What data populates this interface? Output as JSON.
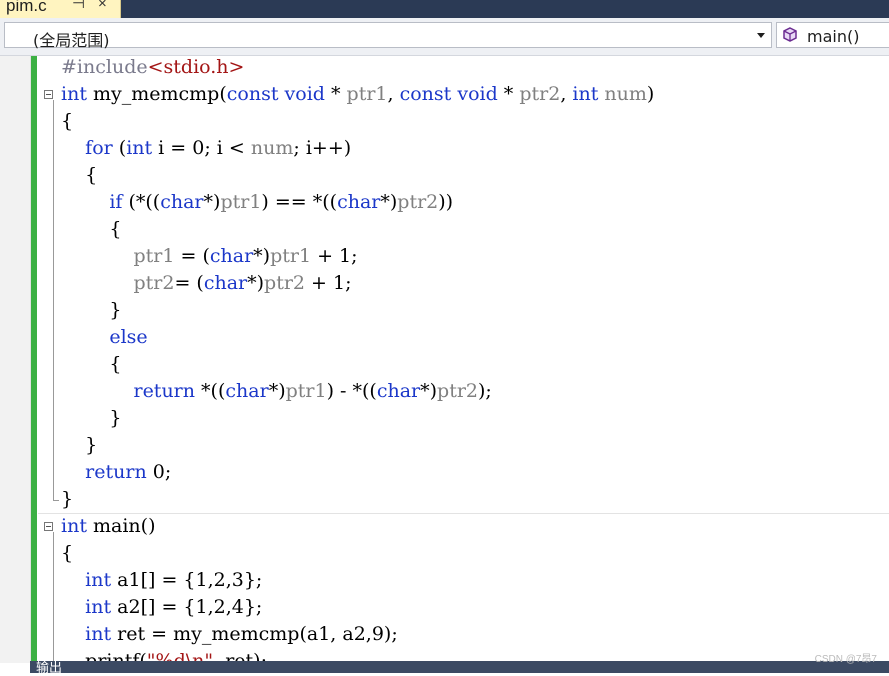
{
  "tab": {
    "filename": "pim.c",
    "pin_glyph": "⊣",
    "close_glyph": "×"
  },
  "navbar": {
    "scope": "(全局范围)",
    "member": "main()"
  },
  "code": [
    [
      {
        "t": "#include",
        "c": "pp"
      },
      {
        "t": "<stdio.h>",
        "c": "str"
      }
    ],
    [
      {
        "t": "int",
        "c": "kw"
      },
      {
        "t": " my_memcmp(",
        "c": ""
      },
      {
        "t": "const",
        "c": "kw"
      },
      {
        "t": " ",
        "c": ""
      },
      {
        "t": "void",
        "c": "kw"
      },
      {
        "t": " * ",
        "c": ""
      },
      {
        "t": "ptr1",
        "c": "param"
      },
      {
        "t": ", ",
        "c": ""
      },
      {
        "t": "const",
        "c": "kw"
      },
      {
        "t": " ",
        "c": ""
      },
      {
        "t": "void",
        "c": "kw"
      },
      {
        "t": " * ",
        "c": ""
      },
      {
        "t": "ptr2",
        "c": "param"
      },
      {
        "t": ", ",
        "c": ""
      },
      {
        "t": "int",
        "c": "kw"
      },
      {
        "t": " ",
        "c": ""
      },
      {
        "t": "num",
        "c": "param"
      },
      {
        "t": ")",
        "c": ""
      }
    ],
    [
      {
        "t": "{",
        "c": ""
      }
    ],
    [
      {
        "t": "    ",
        "c": ""
      },
      {
        "t": "for",
        "c": "kw"
      },
      {
        "t": " (",
        "c": ""
      },
      {
        "t": "int",
        "c": "kw"
      },
      {
        "t": " i = 0; i < ",
        "c": ""
      },
      {
        "t": "num",
        "c": "param"
      },
      {
        "t": "; i++)",
        "c": ""
      }
    ],
    [
      {
        "t": "    {",
        "c": ""
      }
    ],
    [
      {
        "t": "        ",
        "c": ""
      },
      {
        "t": "if",
        "c": "kw"
      },
      {
        "t": " (*((",
        "c": ""
      },
      {
        "t": "char",
        "c": "kw"
      },
      {
        "t": "*)",
        "c": ""
      },
      {
        "t": "ptr1",
        "c": "param"
      },
      {
        "t": ") == *((",
        "c": ""
      },
      {
        "t": "char",
        "c": "kw"
      },
      {
        "t": "*)",
        "c": ""
      },
      {
        "t": "ptr2",
        "c": "param"
      },
      {
        "t": "))",
        "c": ""
      }
    ],
    [
      {
        "t": "        {",
        "c": ""
      }
    ],
    [
      {
        "t": "            ",
        "c": ""
      },
      {
        "t": "ptr1",
        "c": "param"
      },
      {
        "t": " = (",
        "c": ""
      },
      {
        "t": "char",
        "c": "kw"
      },
      {
        "t": "*)",
        "c": ""
      },
      {
        "t": "ptr1",
        "c": "param"
      },
      {
        "t": " + 1;",
        "c": ""
      }
    ],
    [
      {
        "t": "            ",
        "c": ""
      },
      {
        "t": "ptr2",
        "c": "param"
      },
      {
        "t": "= (",
        "c": ""
      },
      {
        "t": "char",
        "c": "kw"
      },
      {
        "t": "*)",
        "c": ""
      },
      {
        "t": "ptr2",
        "c": "param"
      },
      {
        "t": " + 1;",
        "c": ""
      }
    ],
    [
      {
        "t": "        }",
        "c": ""
      }
    ],
    [
      {
        "t": "        ",
        "c": ""
      },
      {
        "t": "else",
        "c": "kw"
      }
    ],
    [
      {
        "t": "        {",
        "c": ""
      }
    ],
    [
      {
        "t": "            ",
        "c": ""
      },
      {
        "t": "return",
        "c": "kw"
      },
      {
        "t": " *((",
        "c": ""
      },
      {
        "t": "char",
        "c": "kw"
      },
      {
        "t": "*)",
        "c": ""
      },
      {
        "t": "ptr1",
        "c": "param"
      },
      {
        "t": ") - *((",
        "c": ""
      },
      {
        "t": "char",
        "c": "kw"
      },
      {
        "t": "*)",
        "c": ""
      },
      {
        "t": "ptr2",
        "c": "param"
      },
      {
        "t": ");",
        "c": ""
      }
    ],
    [
      {
        "t": "        }",
        "c": ""
      }
    ],
    [
      {
        "t": "    }",
        "c": ""
      }
    ],
    [
      {
        "t": "    ",
        "c": ""
      },
      {
        "t": "return",
        "c": "kw"
      },
      {
        "t": " 0;",
        "c": ""
      }
    ],
    [
      {
        "t": "}",
        "c": ""
      }
    ],
    [
      {
        "t": "int",
        "c": "kw"
      },
      {
        "t": " main()",
        "c": ""
      }
    ],
    [
      {
        "t": "{",
        "c": ""
      }
    ],
    [
      {
        "t": "    ",
        "c": ""
      },
      {
        "t": "int",
        "c": "kw"
      },
      {
        "t": " a1[] = {1,2,3};",
        "c": ""
      }
    ],
    [
      {
        "t": "    ",
        "c": ""
      },
      {
        "t": "int",
        "c": "kw"
      },
      {
        "t": " a2[] = {1,2,4};",
        "c": ""
      }
    ],
    [
      {
        "t": "    ",
        "c": ""
      },
      {
        "t": "int",
        "c": "kw"
      },
      {
        "t": " ret = my_memcmp(a1, a2,9);",
        "c": ""
      }
    ],
    [
      {
        "t": "    printf(",
        "c": ""
      },
      {
        "t": "\"%d\\n\"",
        "c": "str"
      },
      {
        "t": ", ret);",
        "c": ""
      }
    ]
  ],
  "output_panel": {
    "title": "输出"
  },
  "watermark": "CSDN @7昂7"
}
